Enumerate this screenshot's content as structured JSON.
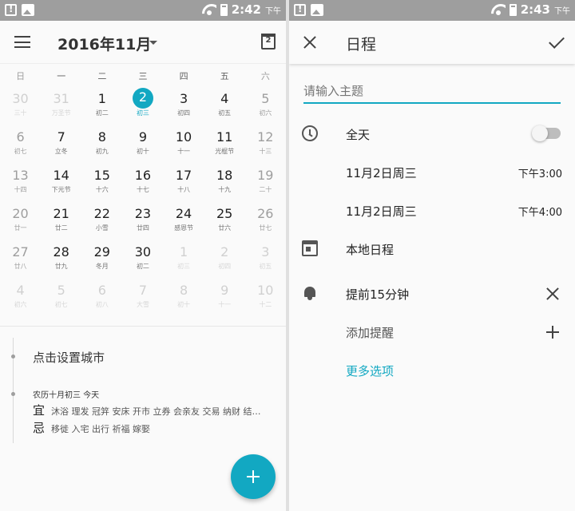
{
  "left": {
    "status": {
      "time": "2:42",
      "ampm": "下午"
    },
    "header": {
      "month_title": "2016年11月",
      "today_num": "2"
    },
    "weekdays": [
      "日",
      "一",
      "二",
      "三",
      "四",
      "五",
      "六"
    ],
    "days": [
      {
        "n": "30",
        "l": "三十",
        "other": true
      },
      {
        "n": "31",
        "l": "万圣节",
        "other": true
      },
      {
        "n": "1",
        "l": "初二"
      },
      {
        "n": "2",
        "l": "初三",
        "selected": true
      },
      {
        "n": "3",
        "l": "初四"
      },
      {
        "n": "4",
        "l": "初五"
      },
      {
        "n": "5",
        "l": "初六"
      },
      {
        "n": "6",
        "l": "初七"
      },
      {
        "n": "7",
        "l": "立冬"
      },
      {
        "n": "8",
        "l": "初九"
      },
      {
        "n": "9",
        "l": "初十"
      },
      {
        "n": "10",
        "l": "十一"
      },
      {
        "n": "11",
        "l": "光棍节"
      },
      {
        "n": "12",
        "l": "十三"
      },
      {
        "n": "13",
        "l": "十四"
      },
      {
        "n": "14",
        "l": "下元节"
      },
      {
        "n": "15",
        "l": "十六"
      },
      {
        "n": "16",
        "l": "十七"
      },
      {
        "n": "17",
        "l": "十八"
      },
      {
        "n": "18",
        "l": "十九"
      },
      {
        "n": "19",
        "l": "二十"
      },
      {
        "n": "20",
        "l": "廿一"
      },
      {
        "n": "21",
        "l": "廿二"
      },
      {
        "n": "22",
        "l": "小雪"
      },
      {
        "n": "23",
        "l": "廿四"
      },
      {
        "n": "24",
        "l": "感恩节"
      },
      {
        "n": "25",
        "l": "廿六"
      },
      {
        "n": "26",
        "l": "廿七"
      },
      {
        "n": "27",
        "l": "廿八"
      },
      {
        "n": "28",
        "l": "廿九"
      },
      {
        "n": "29",
        "l": "冬月"
      },
      {
        "n": "30",
        "l": "初二"
      },
      {
        "n": "1",
        "l": "初三",
        "other": true
      },
      {
        "n": "2",
        "l": "初四",
        "other": true
      },
      {
        "n": "3",
        "l": "初五",
        "other": true
      },
      {
        "n": "4",
        "l": "初六",
        "other": true
      },
      {
        "n": "5",
        "l": "初七",
        "other": true
      },
      {
        "n": "6",
        "l": "初八",
        "other": true
      },
      {
        "n": "7",
        "l": "大雪",
        "other": true
      },
      {
        "n": "8",
        "l": "初十",
        "other": true
      },
      {
        "n": "9",
        "l": "十一",
        "other": true
      },
      {
        "n": "10",
        "l": "十二",
        "other": true
      }
    ],
    "info": {
      "city_prompt": "点击设置城市",
      "lunar_today": "农历十月初三  今天",
      "yi_label": "宜",
      "yi_text": "沐浴 理发 冠笄 安床 开市 立券 会亲友 交易 纳财 结…",
      "ji_label": "忌",
      "ji_text": "移徙 入宅 出行 祈福 嫁娶"
    }
  },
  "right": {
    "status": {
      "time": "2:43",
      "ampm": "下午"
    },
    "header": {
      "title": "日程"
    },
    "subject_placeholder": "请输入主题",
    "all_day_label": "全天",
    "start": {
      "date": "11月2日周三",
      "time": "下午3:00"
    },
    "end": {
      "date": "11月2日周三",
      "time": "下午4:00"
    },
    "calendar_label": "本地日程",
    "reminder_label": "提前15分钟",
    "add_reminder_label": "添加提醒",
    "more_options_label": "更多选项"
  },
  "colors": {
    "accent": "#12a8c2",
    "status_bar": "#9e9e9e"
  }
}
